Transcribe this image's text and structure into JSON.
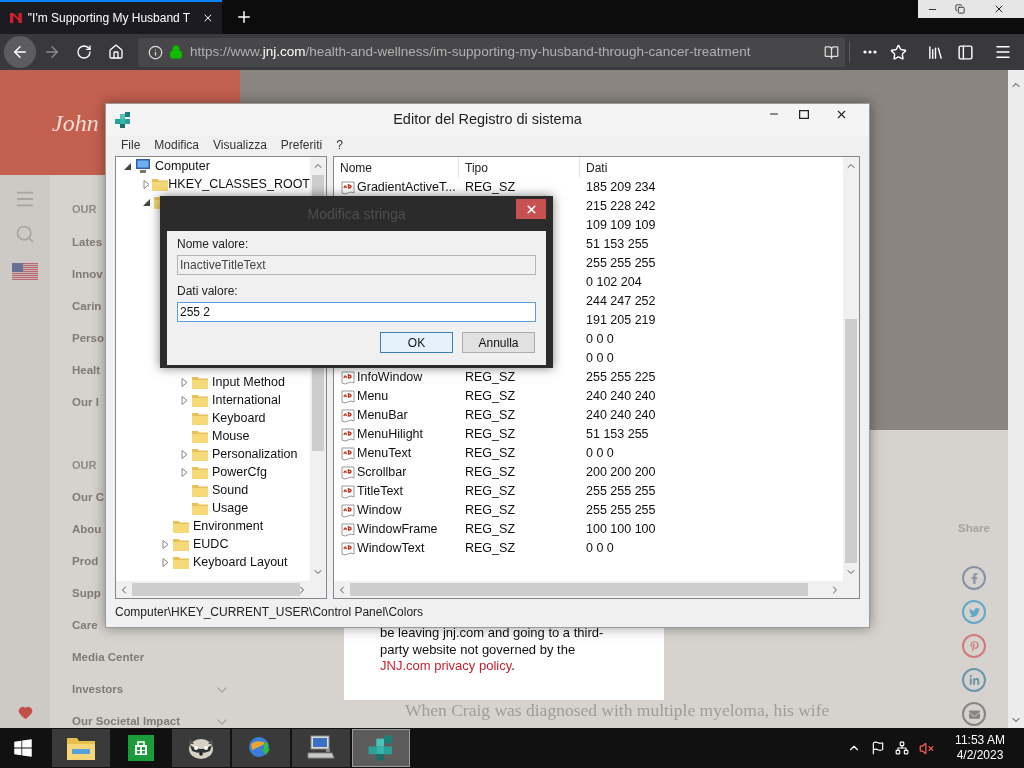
{
  "browser": {
    "tabs": [
      {
        "title": "\"I'm Supporting My Husband T",
        "selected": true
      }
    ],
    "url": {
      "scheme": "https://www.",
      "domain": "jnj.com",
      "path": "/health-and-wellness/im-supporting-my-husband-through-cancer-treatment"
    }
  },
  "website": {
    "logo": "John",
    "nav_sections": [
      {
        "heading": "OUR",
        "items": [
          {
            "label": "Lates",
            "kind": "link"
          },
          {
            "label": "Innov",
            "kind": "link"
          },
          {
            "label": "Carin",
            "kind": "link"
          },
          {
            "label": "Perso",
            "kind": "link"
          },
          {
            "label": "Healt",
            "kind": "link"
          },
          {
            "label": "Our I",
            "kind": "link"
          }
        ]
      },
      {
        "heading": "OUR",
        "items": [
          {
            "label": "Our C",
            "kind": "link"
          },
          {
            "label": "Abou",
            "kind": "link"
          },
          {
            "label": "Prod",
            "kind": "link"
          },
          {
            "label": "Supp",
            "kind": "link"
          },
          {
            "label": "Care",
            "kind": "link"
          },
          {
            "label": "Media Center",
            "kind": "link"
          },
          {
            "label": "Investors",
            "kind": "submenu"
          },
          {
            "label": "Our Societal Impact",
            "kind": "submenu"
          }
        ]
      }
    ],
    "share_label": "Share",
    "notice": {
      "text": "be leaving jnj.com and going to a third-party website not governed by the",
      "link": "JNJ.com privacy policy",
      "tail": "."
    },
    "article_text": "When Craig was diagnosed with multiple myeloma, his wife"
  },
  "registry": {
    "title": "Editor del Registro di sistema",
    "menu": [
      "File",
      "Modifica",
      "Visualizza",
      "Preferiti",
      "?"
    ],
    "tree": [
      {
        "label": "Computer",
        "kind": "computer",
        "expanded": true,
        "children": [
          {
            "label": "HKEY_CLASSES_ROOT",
            "kind": "folder",
            "expanded": false
          },
          {
            "kind": "folder",
            "expanded": true,
            "children": [
              {
                "kind": "folder",
                "expanded": true,
                "children": [
                  {
                    "label": "Input Method",
                    "kind": "folder",
                    "expanded": false
                  },
                  {
                    "label": "International",
                    "kind": "folder",
                    "expanded": false
                  },
                  {
                    "label": "Keyboard",
                    "kind": "folder"
                  },
                  {
                    "label": "Mouse",
                    "kind": "folder"
                  },
                  {
                    "label": "Personalization",
                    "kind": "folder",
                    "expanded": false
                  },
                  {
                    "label": "PowerCfg",
                    "kind": "folder",
                    "expanded": false
                  },
                  {
                    "label": "Sound",
                    "kind": "folder"
                  },
                  {
                    "label": "Usage",
                    "kind": "folder"
                  }
                ]
              },
              {
                "label": "Environment",
                "kind": "folder"
              },
              {
                "label": "EUDC",
                "kind": "folder",
                "expanded": false
              },
              {
                "label": "Keyboard Layout",
                "kind": "folder",
                "expanded": false
              }
            ]
          }
        ]
      }
    ],
    "columns": [
      "Nome",
      "Tipo",
      "Dati"
    ],
    "rows": [
      {
        "name": "GradientActiveT...",
        "type": "REG_SZ",
        "data": "185 209 234"
      },
      {
        "data": "215 228 242"
      },
      {
        "data": "109 109 109"
      },
      {
        "data": "51 153 255"
      },
      {
        "data": "255 255 255"
      },
      {
        "data": "0 102 204"
      },
      {
        "data": "244 247 252"
      },
      {
        "data": "191 205 219"
      },
      {
        "data": "0 0 0"
      },
      {
        "data": "0 0 0"
      },
      {
        "name": "InfoWindow",
        "type": "REG_SZ",
        "data": "255 255 225"
      },
      {
        "name": "Menu",
        "type": "REG_SZ",
        "data": "240 240 240"
      },
      {
        "name": "MenuBar",
        "type": "REG_SZ",
        "data": "240 240 240"
      },
      {
        "name": "MenuHilight",
        "type": "REG_SZ",
        "data": "51 153 255"
      },
      {
        "name": "MenuText",
        "type": "REG_SZ",
        "data": "0 0 0"
      },
      {
        "name": "Scrollbar",
        "type": "REG_SZ",
        "data": "200 200 200"
      },
      {
        "name": "TitleText",
        "type": "REG_SZ",
        "data": "255 255 255"
      },
      {
        "name": "Window",
        "type": "REG_SZ",
        "data": "255 255 255"
      },
      {
        "name": "WindowFrame",
        "type": "REG_SZ",
        "data": "100 100 100"
      },
      {
        "name": "WindowText",
        "type": "REG_SZ",
        "data": "0 0 0"
      }
    ],
    "status": "Computer\\HKEY_CURRENT_USER\\Control Panel\\Colors"
  },
  "dialog": {
    "title": "Modifica stringa",
    "name_label": "Nome valore:",
    "name_value": "InactiveTitleText",
    "data_label": "Dati valore:",
    "data_value": "255 2",
    "buttons": [
      {
        "label": "OK",
        "default": true
      },
      {
        "label": "Annulla",
        "default": false
      }
    ]
  },
  "taskbar": {
    "apps": [
      {
        "kind": "explorer",
        "running": true,
        "selected": false
      },
      {
        "kind": "store",
        "running": false,
        "selected": false
      },
      {
        "kind": "raccoon",
        "running": true,
        "selected": false
      },
      {
        "kind": "globe",
        "running": true,
        "selected": false
      },
      {
        "kind": "computer",
        "running": true,
        "selected": false
      },
      {
        "kind": "registry",
        "running": true,
        "selected": true
      }
    ],
    "time": "11:53 AM",
    "date": "4/2/2023"
  }
}
